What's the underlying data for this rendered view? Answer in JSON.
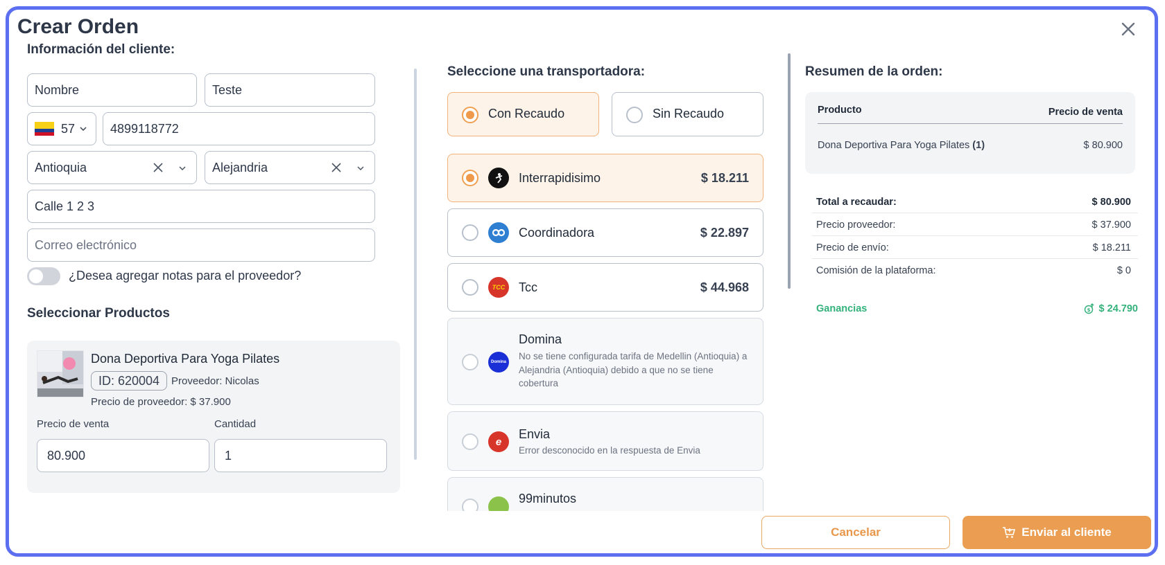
{
  "modal": {
    "title": "Crear Orden"
  },
  "client": {
    "section_title": "Información del cliente:",
    "first_name": "Nombre",
    "last_name": "Teste",
    "phone_code": "57",
    "phone": "4899118772",
    "state": "Antioquia",
    "city": "Alejandria",
    "address": "Calle 1 2 3",
    "email_placeholder": "Correo electrónico",
    "notes_toggle_label": "¿Desea agregar notas para el proveedor?",
    "notes_toggle_on": false
  },
  "products": {
    "section_title": "Seleccionar Productos",
    "items": [
      {
        "name": "Dona Deportiva Para Yoga Pilates",
        "id_label": "ID: 620004",
        "supplier": "Proveedor: Nicolas",
        "supplier_price": "Precio de proveedor: $ 37.900",
        "sale_price_label": "Precio de venta",
        "sale_price": "80.900",
        "quantity_label": "Cantidad",
        "quantity": "1"
      }
    ]
  },
  "shipping": {
    "section_title": "Seleccione una transportadora:",
    "payment_modes": [
      {
        "label": "Con Recaudo",
        "selected": true
      },
      {
        "label": "Sin Recaudo",
        "selected": false
      }
    ],
    "carriers": [
      {
        "name": "Interrapidisimo",
        "price": "$ 18.211",
        "selected": true,
        "icon": "interrapidisimo-logo",
        "color": "#111111"
      },
      {
        "name": "Coordinadora",
        "price": "$ 22.897",
        "selected": false,
        "icon": "coordinadora-logo",
        "color": "#2e7fd1"
      },
      {
        "name": "Tcc",
        "price": "$ 44.968",
        "selected": false,
        "icon": "tcc-logo",
        "color": "#d8352a"
      },
      {
        "name": "Domina",
        "price": "",
        "disabled": true,
        "note": "No se tiene configurada tarifa de Medellin (Antioquia) a Alejandria (Antioquia) debido a que no se tiene cobertura",
        "icon": "domina-logo",
        "color": "#1b2fd6"
      },
      {
        "name": "Envia",
        "price": "",
        "disabled": true,
        "note": "Error desconocido en la respuesta de Envia",
        "icon": "envia-logo",
        "color": "#d8352a"
      },
      {
        "name": "99minutos",
        "price": "",
        "disabled": true,
        "note": "",
        "icon": "99minutos-logo",
        "color": "#8bc34a"
      }
    ]
  },
  "summary": {
    "section_title": "Resumen de la orden:",
    "col_product": "Producto",
    "col_price": "Precio de venta",
    "item_name": "Dona Deportiva Para Yoga Pilates",
    "item_qty": "(1)",
    "item_price": "$ 80.900",
    "rows": [
      {
        "label": "Total a recaudar:",
        "value": "$ 80.900",
        "bold": true
      },
      {
        "label": "Precio proveedor:",
        "value": "$ 37.900"
      },
      {
        "label": "Precio de envío:",
        "value": "$ 18.211"
      },
      {
        "label": "Comisión de la plataforma:",
        "value": "$ 0"
      }
    ],
    "gain_label": "Ganancias",
    "gain_value": "$ 24.790"
  },
  "footer": {
    "cancel_label": "Cancelar",
    "send_label": "Enviar al cliente"
  },
  "colors": {
    "accent": "#eb9e52",
    "frame": "#5b6ff0",
    "gain": "#34b27b"
  }
}
